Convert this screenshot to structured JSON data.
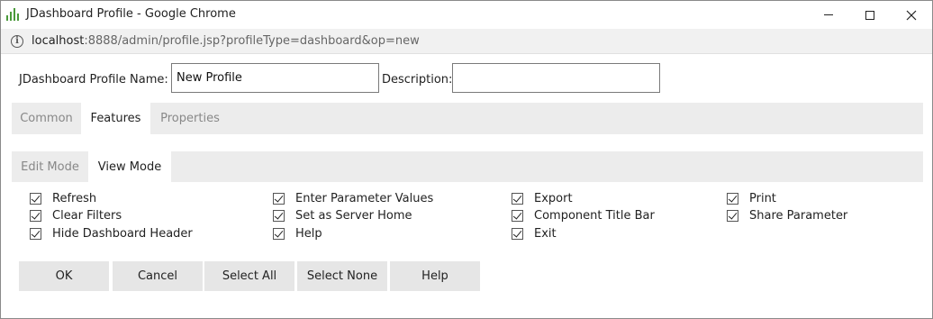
{
  "window": {
    "title": "JDashboard Profile - Google Chrome"
  },
  "address": {
    "host": "localhost",
    "rest": ":8888/admin/profile.jsp?profileType=dashboard&op=new"
  },
  "form": {
    "name_label": "JDashboard Profile Name:",
    "name_value": "New Profile",
    "desc_label": "Description:",
    "desc_value": ""
  },
  "main_tabs": [
    {
      "label": "Common",
      "active": false
    },
    {
      "label": "Features",
      "active": true
    },
    {
      "label": "Properties",
      "active": false
    }
  ],
  "sub_tabs": [
    {
      "label": "Edit Mode",
      "active": false
    },
    {
      "label": "View Mode",
      "active": true
    }
  ],
  "checkboxes": [
    {
      "label": "Refresh",
      "checked": true
    },
    {
      "label": "Clear Filters",
      "checked": true
    },
    {
      "label": "Hide Dashboard Header",
      "checked": true
    },
    {
      "label": "Enter Parameter Values",
      "checked": true
    },
    {
      "label": "Set as Server Home",
      "checked": true
    },
    {
      "label": "Help",
      "checked": true
    },
    {
      "label": "Export",
      "checked": true
    },
    {
      "label": "Component Title Bar",
      "checked": true
    },
    {
      "label": "Exit",
      "checked": true
    },
    {
      "label": "Print",
      "checked": true
    },
    {
      "label": "Share Parameter",
      "checked": true
    }
  ],
  "buttons": {
    "ok": "OK",
    "cancel": "Cancel",
    "select_all": "Select All",
    "select_none": "Select None",
    "help": "Help"
  }
}
